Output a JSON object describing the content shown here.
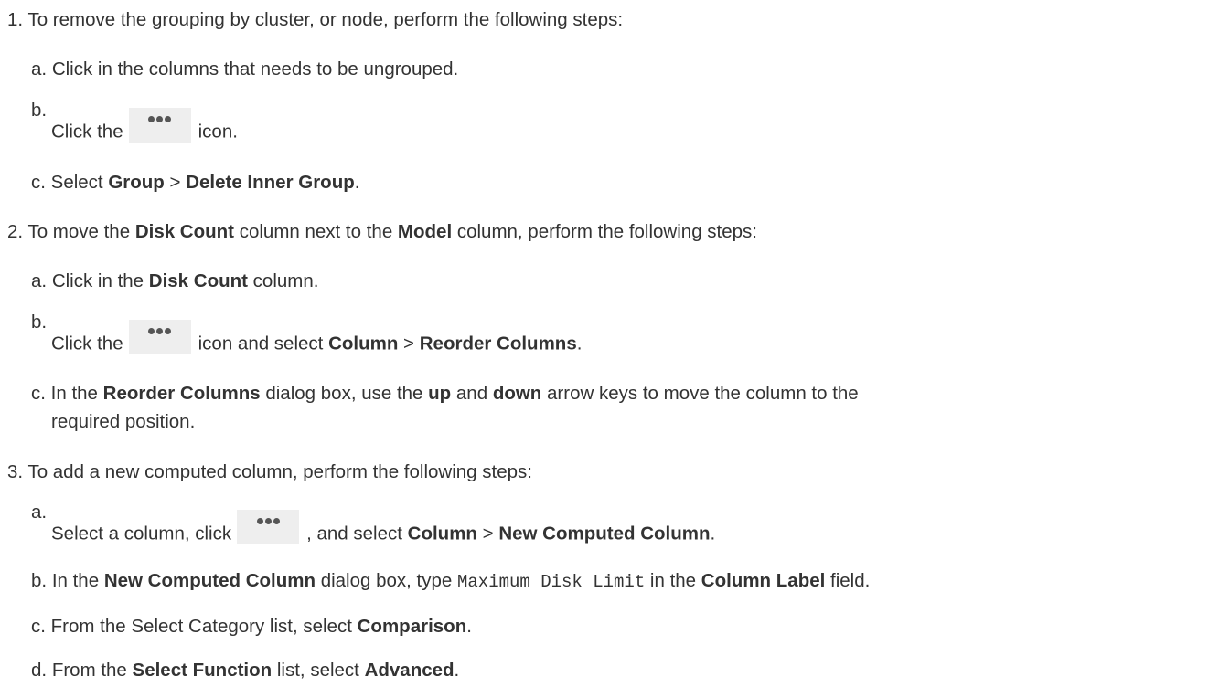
{
  "step1": {
    "num": "1.",
    "text": "To remove the grouping by cluster, or node, perform the following steps:",
    "a": {
      "letter": "a.",
      "text": "Click in the columns that needs to be ungrouped."
    },
    "b": {
      "letter": "b.",
      "pre": "Click the",
      "post": "icon.",
      "icon": "more-options-icon"
    },
    "c": {
      "letter": "c.",
      "pre": "Select ",
      "bold1": "Group",
      "mid": " > ",
      "bold2": "Delete Inner Group",
      "post": "."
    }
  },
  "step2": {
    "num": "2.",
    "pre": "To move the ",
    "bold1": "Disk Count",
    "mid": " column next to the ",
    "bold2": "Model",
    "post": " column, perform the following steps:",
    "a": {
      "letter": "a.",
      "pre": "Click in the ",
      "bold1": "Disk Count",
      "post": " column."
    },
    "b": {
      "letter": "b.",
      "pre": "Click the",
      "mid": "icon and select ",
      "bold1": "Column",
      "sep": " > ",
      "bold2": "Reorder Columns",
      "post": ".",
      "icon": "more-options-icon"
    },
    "c": {
      "letter": "c.",
      "pre": "In the ",
      "bold1": "Reorder Columns",
      "mid1": " dialog box, use the ",
      "bold2": "up",
      "mid2": " and ",
      "bold3": "down",
      "post": " arrow keys to move the column to the",
      "line2": "required position."
    }
  },
  "step3": {
    "num": "3.",
    "text": "To add a new computed column, perform the following steps:",
    "a": {
      "letter": "a.",
      "pre": "Select a column, click",
      "mid": ", and select ",
      "bold1": "Column",
      "sep": " > ",
      "bold2": "New Computed Column",
      "post": ".",
      "icon": "more-options-icon"
    },
    "b": {
      "letter": "b.",
      "pre": "In the ",
      "bold1": "New Computed Column",
      "mid1": " dialog box, type ",
      "code": "Maximum Disk Limit",
      "mid2": " in the ",
      "bold2": "Column Label",
      "post": " field."
    },
    "c": {
      "letter": "c.",
      "pre": "From the Select Category list, select ",
      "bold1": "Comparison",
      "post": "."
    },
    "d": {
      "letter": "d.",
      "pre": "From the ",
      "bold1": "Select Function",
      "mid": " list, select ",
      "bold2": "Advanced",
      "post": "."
    }
  }
}
